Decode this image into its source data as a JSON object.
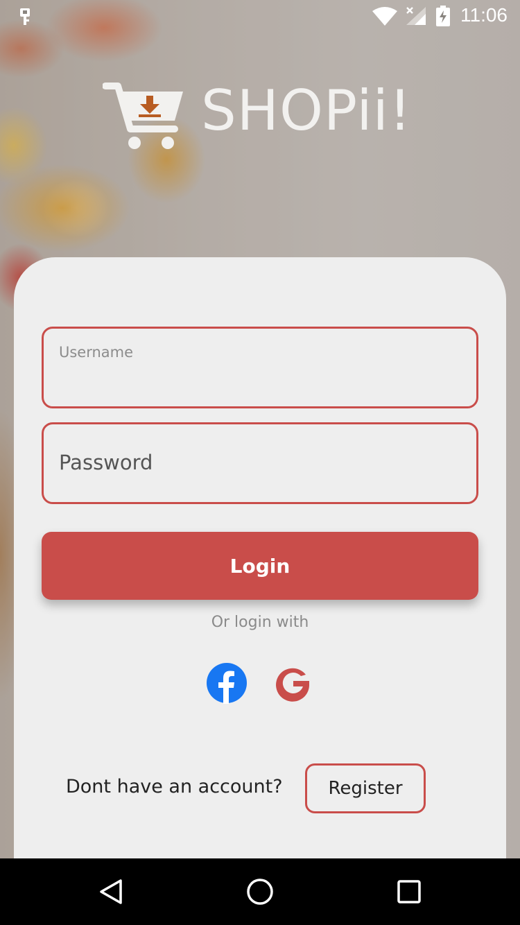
{
  "status_bar": {
    "time": "11:06",
    "icons": [
      "key-icon",
      "wifi-icon",
      "signal-icon",
      "battery-charging-icon"
    ]
  },
  "brand": {
    "logo_icon": "cart-download-icon",
    "name": "SHOPii!"
  },
  "form": {
    "username": {
      "label": "Username",
      "value": ""
    },
    "password": {
      "placeholder": "Password",
      "value": ""
    },
    "login_label": "Login",
    "or_text": "Or login with",
    "social": [
      {
        "icon": "facebook-icon",
        "color": "#1877f2"
      },
      {
        "icon": "google-icon",
        "color": "#c94d4a"
      }
    ]
  },
  "register": {
    "prompt": "Dont have an account?",
    "button_label": "Register"
  },
  "nav_bar": {
    "icons": [
      "back-icon",
      "home-icon",
      "recent-apps-icon"
    ]
  },
  "colors": {
    "accent": "#c94d4a",
    "card_background": "#eeeeee",
    "facebook": "#1877f2"
  }
}
